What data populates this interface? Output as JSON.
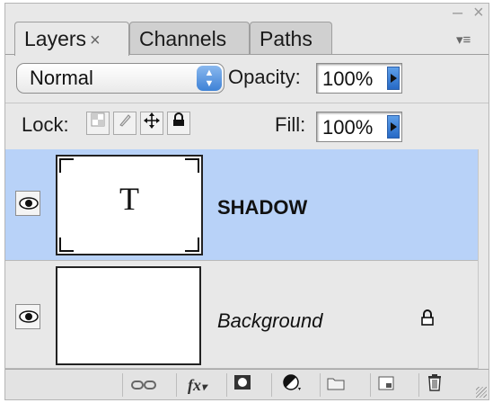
{
  "window": {
    "minimize_glyph": "–",
    "close_glyph": "×",
    "menu_glyph": "▾≡"
  },
  "tabs": [
    {
      "label": "Layers",
      "active": true,
      "close_glyph": "×"
    },
    {
      "label": "Channels",
      "active": false
    },
    {
      "label": "Paths",
      "active": false
    }
  ],
  "blend_mode": {
    "value": "Normal",
    "arrows": "▲\n▼"
  },
  "opacity": {
    "label": "Opacity:",
    "value": "100%"
  },
  "lock": {
    "label": "Lock:",
    "icons": [
      "lock-transparent-pixels-icon",
      "lock-image-pixels-icon",
      "lock-position-icon",
      "lock-all-icon"
    ]
  },
  "fill": {
    "label": "Fill:",
    "value": "100%"
  },
  "layers": [
    {
      "name": "SHADOW",
      "type": "text",
      "thumb_glyph": "T",
      "visible": true,
      "selected": true,
      "locked": false
    },
    {
      "name": "Background",
      "type": "background",
      "visible": true,
      "selected": false,
      "locked": true
    }
  ],
  "bottom_tools": [
    "link-layers-icon",
    "layer-style-fx-icon",
    "add-mask-icon",
    "adjustment-layer-icon",
    "new-group-folder-icon",
    "new-layer-icon",
    "trash-icon"
  ],
  "fx_label": "fx",
  "colors": {
    "selection": "#b8d2f8",
    "panel": "#e8e8e8",
    "accent": "#3e82d6"
  }
}
